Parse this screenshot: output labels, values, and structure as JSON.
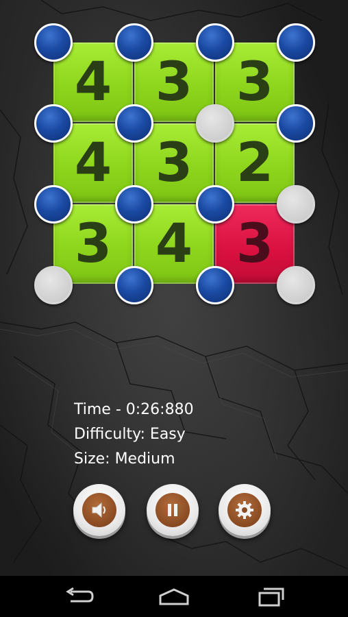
{
  "board": {
    "tiles": [
      {
        "value": "4",
        "color": "green"
      },
      {
        "value": "3",
        "color": "green"
      },
      {
        "value": "3",
        "color": "green"
      },
      {
        "value": "4",
        "color": "green"
      },
      {
        "value": "3",
        "color": "green"
      },
      {
        "value": "2",
        "color": "green"
      },
      {
        "value": "3",
        "color": "green"
      },
      {
        "value": "4",
        "color": "green"
      },
      {
        "value": "3",
        "color": "red"
      }
    ],
    "nodes": [
      [
        "blue",
        "blue",
        "blue",
        "blue"
      ],
      [
        "blue",
        "blue",
        "grey",
        "blue"
      ],
      [
        "blue",
        "blue",
        "blue",
        "grey"
      ],
      [
        "grey",
        "blue",
        "blue",
        "grey"
      ]
    ],
    "colors": {
      "tile_green": "#8ed61d",
      "tile_red": "#d9103f",
      "node_blue": "#1b4aa3",
      "node_grey": "#cfcfcf"
    }
  },
  "info": {
    "time": "Time - 0:26:880",
    "difficulty": "Difficulty: Easy",
    "size": "Size: Medium"
  },
  "controls": [
    {
      "icon": "speaker-icon"
    },
    {
      "icon": "pause-icon"
    },
    {
      "icon": "gear-icon"
    }
  ],
  "navbar": [
    {
      "icon": "back-icon"
    },
    {
      "icon": "home-icon"
    },
    {
      "icon": "recent-apps-icon"
    }
  ]
}
